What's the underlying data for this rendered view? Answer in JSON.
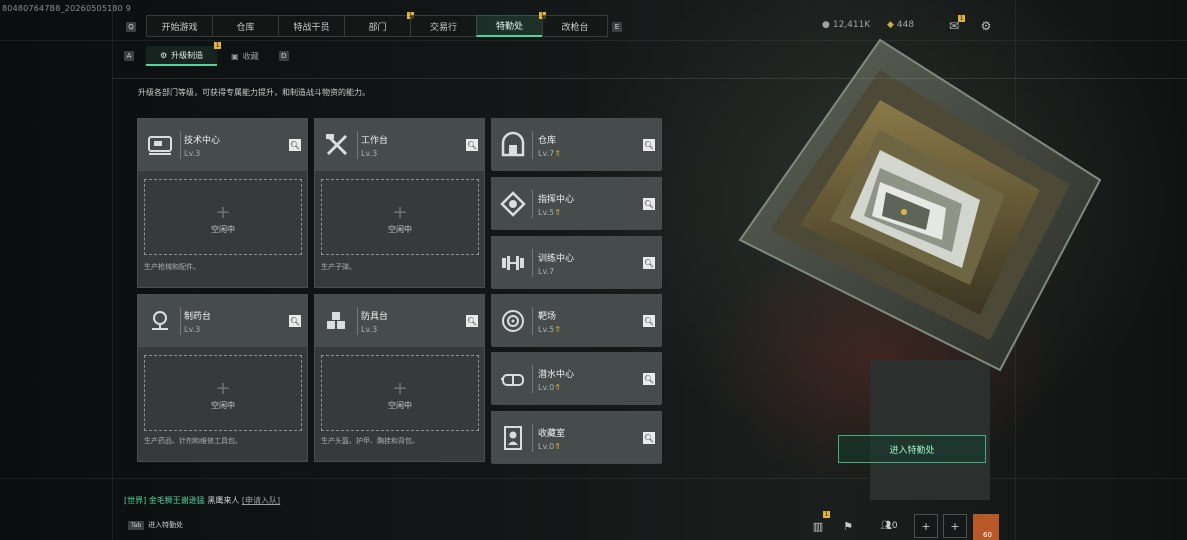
{
  "watermark": "804807647B8_20260505180 9",
  "top_nav": {
    "key_left": "Q",
    "key_right": "E",
    "tabs": [
      {
        "label": "开始游戏",
        "badge": ""
      },
      {
        "label": "仓库",
        "badge": ""
      },
      {
        "label": "特战干员",
        "badge": ""
      },
      {
        "label": "部门",
        "badge": "1"
      },
      {
        "label": "交易行",
        "badge": ""
      },
      {
        "label": "特勤处",
        "badge": "1",
        "active": true
      },
      {
        "label": "改枪台",
        "badge": ""
      }
    ]
  },
  "sub_nav": {
    "key_left": "A",
    "key_right": "D",
    "tabs": [
      {
        "label": "升级制造",
        "badge": "1",
        "active": true
      },
      {
        "label": "收藏",
        "badge": ""
      }
    ]
  },
  "header_right": {
    "currency1": "12,411K",
    "currency2": "448",
    "mail_badge": "1"
  },
  "intro": "升级各部门等级，可获得专属能力提升，和制造战斗物资的能力。",
  "big_cards": [
    {
      "name": "技术中心",
      "level": "Lv.3",
      "icon": "circuit-board-icon",
      "slot_status": "空闲中",
      "desc": "生产枪械和配件。"
    },
    {
      "name": "工作台",
      "level": "Lv.3",
      "icon": "hammer-wrench-icon",
      "slot_status": "空闲中",
      "desc": "生产子弹。"
    },
    {
      "name": "制药台",
      "level": "Lv.3",
      "icon": "microscope-icon",
      "slot_status": "空闲中",
      "desc": "生产药品、针剂和维修工具包。"
    },
    {
      "name": "防具台",
      "level": "Lv.3",
      "icon": "armor-blocks-icon",
      "slot_status": "空闲中",
      "desc": "生产头盔、护甲、胸挂和背包。"
    }
  ],
  "small_cards": [
    {
      "name": "仓库",
      "level": "Lv.7",
      "upgrade": true,
      "icon": "vault-icon"
    },
    {
      "name": "指挥中心",
      "level": "Lv.5",
      "upgrade": true,
      "icon": "command-center-icon"
    },
    {
      "name": "训练中心",
      "level": "Lv.7",
      "upgrade": false,
      "icon": "dumbbell-icon"
    },
    {
      "name": "靶场",
      "level": "Lv.5",
      "upgrade": true,
      "icon": "target-icon"
    },
    {
      "name": "潜水中心",
      "level": "Lv.0",
      "upgrade": true,
      "icon": "diving-mask-icon"
    },
    {
      "name": "收藏室",
      "level": "Lv.0",
      "upgrade": true,
      "icon": "portrait-frame-icon"
    }
  ],
  "enter_button": "进入特勤处",
  "chat": {
    "channel": "[世界]",
    "user": "金毛狮王谢逊猛",
    "message": "黑鹰来人",
    "link": "[申请入队]"
  },
  "tab_hint": {
    "key": "Tab",
    "label": "进入特勤处"
  },
  "bottom": {
    "stats_badge": "1",
    "friends_count": "0",
    "level": "60"
  },
  "colors": {
    "accent": "#4fd6a0",
    "badge": "#e4b43a",
    "card": "#3a3e3e"
  }
}
